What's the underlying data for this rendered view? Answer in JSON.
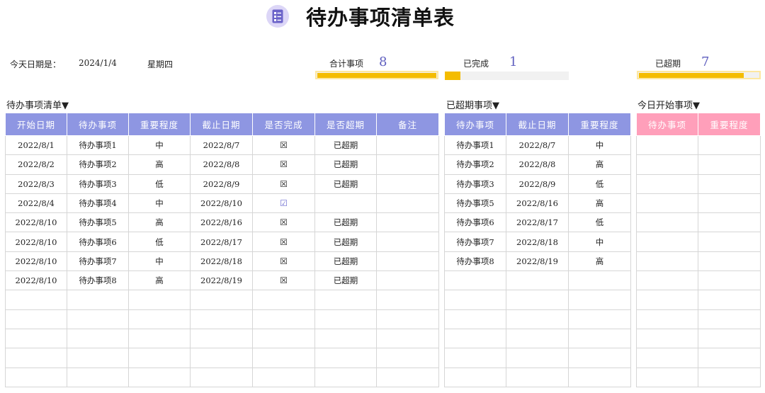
{
  "title": "待办事项清单表",
  "icon": "checklist-icon",
  "header": {
    "today_label": "今天日期是：",
    "today_date": "2024/1/4",
    "weekday": "星期四",
    "total_label": "合计事项",
    "total_value": "8",
    "done_label": "已完成",
    "done_value": "1",
    "overdue_label": "已超期",
    "overdue_value": "7",
    "total_bar_fraction": 1.0,
    "done_bar_fraction": 0.125,
    "overdue_bar_fraction": 0.875
  },
  "colors": {
    "header_blue": "#8e96e2",
    "header_pink": "#ff9fba",
    "bar_yellow": "#f4bc00",
    "number_purple": "#5f5fbf"
  },
  "main_table": {
    "label": "待办事项清单▼",
    "columns": [
      "开始日期",
      "待办事项",
      "重要程度",
      "截止日期",
      "是否完成",
      "是否超期",
      "备注"
    ],
    "rows": [
      [
        "2022/8/1",
        "待办事项1",
        "中",
        "2022/8/7",
        "☒",
        "已超期",
        ""
      ],
      [
        "2022/8/2",
        "待办事项2",
        "高",
        "2022/8/8",
        "☒",
        "已超期",
        ""
      ],
      [
        "2022/8/3",
        "待办事项3",
        "低",
        "2022/8/9",
        "☒",
        "已超期",
        ""
      ],
      [
        "2022/8/4",
        "待办事项4",
        "中",
        "2022/8/10",
        "☑",
        "",
        ""
      ],
      [
        "2022/8/10",
        "待办事项5",
        "高",
        "2022/8/16",
        "☒",
        "已超期",
        ""
      ],
      [
        "2022/8/10",
        "待办事项6",
        "低",
        "2022/8/17",
        "☒",
        "已超期",
        ""
      ],
      [
        "2022/8/10",
        "待办事项7",
        "中",
        "2022/8/18",
        "☒",
        "已超期",
        ""
      ],
      [
        "2022/8/10",
        "待办事项8",
        "高",
        "2022/8/19",
        "☒",
        "已超期",
        ""
      ]
    ],
    "empty_rows": 5
  },
  "overdue_table": {
    "label": "已超期事项▼",
    "columns": [
      "待办事项",
      "截止日期",
      "重要程度"
    ],
    "rows": [
      [
        "待办事项1",
        "2022/8/7",
        "中"
      ],
      [
        "待办事项2",
        "2022/8/8",
        "高"
      ],
      [
        "待办事项3",
        "2022/8/9",
        "低"
      ],
      [
        "待办事项5",
        "2022/8/16",
        "高"
      ],
      [
        "待办事项6",
        "2022/8/17",
        "低"
      ],
      [
        "待办事项7",
        "2022/8/18",
        "中"
      ],
      [
        "待办事项8",
        "2022/8/19",
        "高"
      ]
    ],
    "empty_rows": 6
  },
  "today_table": {
    "label": "今日开始事项▼",
    "columns": [
      "待办事项",
      "重要程度"
    ],
    "rows": [],
    "empty_rows": 13
  }
}
